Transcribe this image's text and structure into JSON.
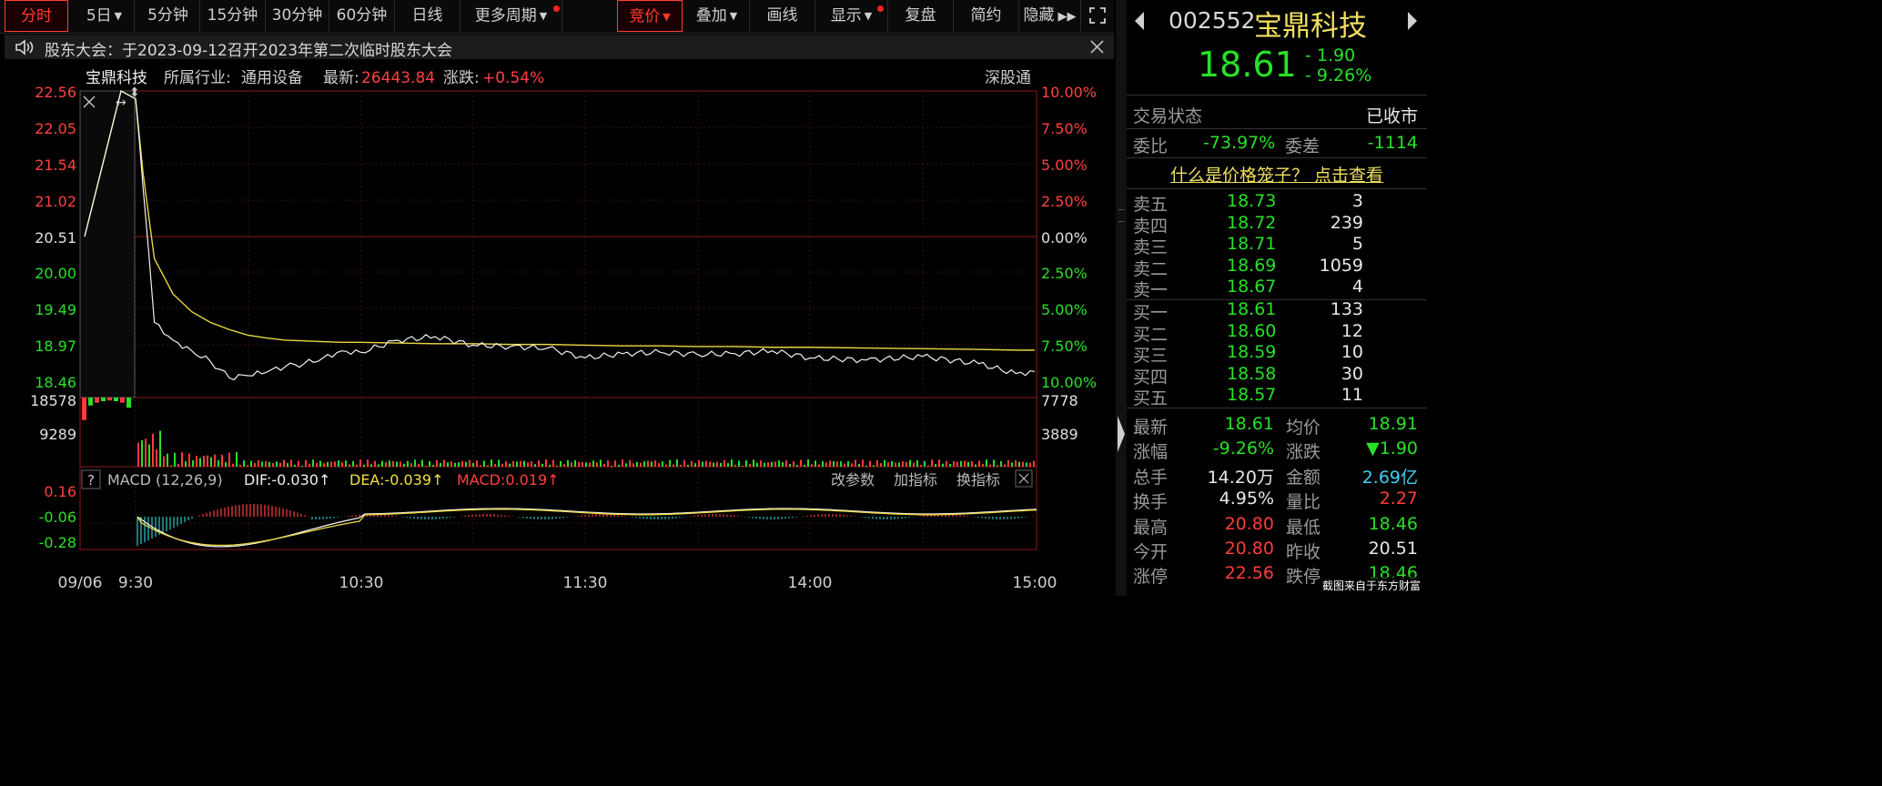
{
  "toolbar": {
    "periods": [
      "分时",
      "5日",
      "5分钟",
      "15分钟",
      "30分钟",
      "60分钟",
      "日线",
      "更多周期"
    ],
    "tools": [
      "竞价",
      "叠加",
      "画线",
      "显示",
      "复盘",
      "简约",
      "隐藏"
    ]
  },
  "notice": {
    "text": "股东大会：于2023-09-12召开2023年第二次临时股东大会"
  },
  "header": {
    "name": "宝鼎科技",
    "industry_label": "所属行业:",
    "industry": "通用设备",
    "latest_label": "最新:",
    "latest": "26443.84",
    "change_label": "涨跌:",
    "change": "+0.54%",
    "channel": "深股通"
  },
  "price_axis": {
    "left": [
      "22.56",
      "22.05",
      "21.54",
      "21.02",
      "20.51",
      "20.00",
      "19.49",
      "18.97",
      "18.46"
    ],
    "right": [
      "10.00%",
      "7.50%",
      "5.00%",
      "2.50%",
      "0.00%",
      "2.50%",
      "5.00%",
      "7.50%",
      "10.00%"
    ]
  },
  "volume_axis": {
    "left": [
      "18578",
      "9289"
    ],
    "right": [
      "7778",
      "3889"
    ]
  },
  "macd": {
    "help": "?",
    "label": "MACD (12,26,9)",
    "dif": "DIF:-0.030↑",
    "dea": "DEA:-0.039↑",
    "macd": "MACD:0.019↑",
    "axis": [
      "0.16",
      "-0.06",
      "-0.28"
    ],
    "buttons": [
      "改参数",
      "加指标",
      "换指标"
    ]
  },
  "time_axis": [
    "09/06",
    "9:30",
    "10:30",
    "11:30",
    "14:00",
    "15:00"
  ],
  "chart_data": {
    "type": "line",
    "x": [
      "9:15",
      "9:25",
      "9:30",
      "9:32",
      "9:35",
      "9:40",
      "9:45",
      "9:50",
      "9:55",
      "10:00",
      "10:05",
      "10:10",
      "10:15",
      "10:20",
      "10:25",
      "10:30",
      "10:40",
      "10:50",
      "11:00",
      "11:10",
      "11:20",
      "11:30",
      "13:10",
      "13:20",
      "13:30",
      "13:40",
      "13:50",
      "14:00",
      "14:15",
      "14:30",
      "14:45",
      "14:55",
      "15:00"
    ],
    "series": [
      {
        "name": "price",
        "values": [
          20.51,
          22.56,
          22.45,
          21.2,
          19.3,
          19.05,
          18.9,
          18.75,
          18.52,
          18.55,
          18.6,
          18.68,
          18.72,
          18.8,
          18.9,
          18.88,
          19.05,
          19.1,
          18.98,
          18.96,
          18.94,
          18.8,
          18.86,
          18.88,
          18.85,
          18.86,
          18.9,
          18.8,
          18.77,
          18.82,
          18.72,
          18.58,
          18.61
        ]
      },
      {
        "name": "average",
        "values": [
          20.51,
          22.56,
          22.45,
          21.4,
          20.2,
          19.7,
          19.45,
          19.3,
          19.2,
          19.12,
          19.08,
          19.05,
          19.04,
          19.03,
          19.02,
          19.02,
          19.01,
          19.0,
          19.0,
          18.99,
          18.99,
          18.98,
          18.97,
          18.97,
          18.96,
          18.96,
          18.95,
          18.95,
          18.94,
          18.93,
          18.92,
          18.91,
          18.91
        ]
      }
    ],
    "ylim": [
      18.46,
      22.56
    ]
  },
  "panel": {
    "code": "002552",
    "name": "宝鼎科技",
    "price": "18.61",
    "change": "- 1.90",
    "change_pct": "- 9.26%",
    "status_label": "交易状态",
    "status": "已收市",
    "wb_label": "委比",
    "wb": "-73.97%",
    "wc_label": "委差",
    "wc": "-1114",
    "cage_link": "什么是价格笼子？ 点击查看",
    "asks": [
      {
        "label": "卖五",
        "price": "18.73",
        "vol": "3"
      },
      {
        "label": "卖四",
        "price": "18.72",
        "vol": "239"
      },
      {
        "label": "卖三",
        "price": "18.71",
        "vol": "5"
      },
      {
        "label": "卖二",
        "price": "18.69",
        "vol": "1059"
      },
      {
        "label": "卖一",
        "price": "18.67",
        "vol": "4"
      }
    ],
    "bids": [
      {
        "label": "买一",
        "price": "18.61",
        "vol": "133"
      },
      {
        "label": "买二",
        "price": "18.60",
        "vol": "12"
      },
      {
        "label": "买三",
        "price": "18.59",
        "vol": "10"
      },
      {
        "label": "买四",
        "price": "18.58",
        "vol": "30"
      },
      {
        "label": "买五",
        "price": "18.57",
        "vol": "11"
      }
    ],
    "stats": [
      {
        "l1": "最新",
        "v1": "18.61",
        "l2": "均价",
        "v2": "18.91"
      },
      {
        "l1": "涨幅",
        "v1": "-9.26%",
        "l2": "涨跌",
        "v2": "▼1.90"
      },
      {
        "l1": "总手",
        "v1": "14.20万",
        "l2": "金额",
        "v2": "2.69亿"
      },
      {
        "l1": "换手",
        "v1": "4.95%",
        "l2": "量比",
        "v2": "2.27"
      },
      {
        "l1": "最高",
        "v1": "20.80",
        "l2": "最低",
        "v2": "18.46"
      },
      {
        "l1": "今开",
        "v1": "20.80",
        "l2": "昨收",
        "v2": "20.51"
      },
      {
        "l1": "涨停",
        "v1": "22.56",
        "l2": "跌停",
        "v2": "18.46"
      }
    ]
  },
  "watermark": "截图来自于东方财富"
}
